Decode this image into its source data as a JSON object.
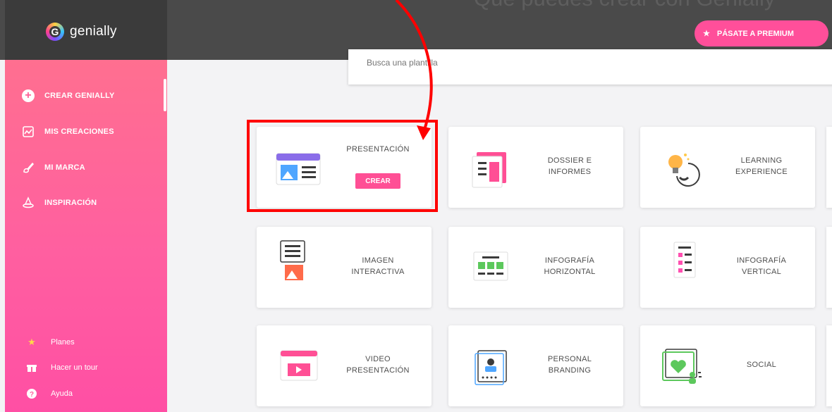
{
  "header": {
    "logo_letter": "G",
    "brand": "genially",
    "heading": "Qué puedes crear con Genially",
    "premium_label": "PÁSATE A PREMIUM"
  },
  "sidebar": {
    "items": [
      {
        "label": "CREAR GENIALLY",
        "icon": "plus-circle-icon"
      },
      {
        "label": "MIS CREACIONES",
        "icon": "chart-icon"
      },
      {
        "label": "MI MARCA",
        "icon": "brush-icon"
      },
      {
        "label": "INSPIRACIÓN",
        "icon": "hat-icon"
      }
    ],
    "bottom": [
      {
        "label": "Planes",
        "icon": "star-icon"
      },
      {
        "label": "Hacer un tour",
        "icon": "gift-icon"
      },
      {
        "label": "Ayuda",
        "icon": "help-icon"
      }
    ]
  },
  "search": {
    "placeholder": "Busca una plantilla"
  },
  "cards": [
    {
      "line1": "PRESENTACIÓN",
      "line2": "",
      "button": "CREAR"
    },
    {
      "line1": "DOSSIER E",
      "line2": "INFORMES"
    },
    {
      "line1": "LEARNING",
      "line2": "EXPERIENCE"
    },
    {
      "line1": "IMAGEN",
      "line2": "INTERACTIVA"
    },
    {
      "line1": "INFOGRAFÍA",
      "line2": "HORIZONTAL"
    },
    {
      "line1": "INFOGRAFÍA",
      "line2": "VERTICAL"
    },
    {
      "line1": "VIDEO",
      "line2": "PRESENTACIÓN"
    },
    {
      "line1": "PERSONAL",
      "line2": "BRANDING"
    },
    {
      "line1": "SOCIAL",
      "line2": ""
    }
  ],
  "colors": {
    "accent": "#ff4f95",
    "sidebar_top": "#ff6f90",
    "sidebar_bottom": "#ff4fa4",
    "highlight": "#ff0000"
  }
}
